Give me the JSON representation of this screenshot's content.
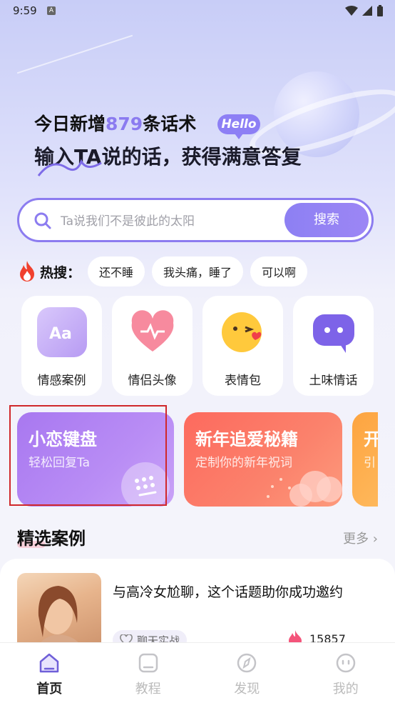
{
  "status": {
    "time": "9:59",
    "notif_letter": "A"
  },
  "hero": {
    "line1_prefix": "今日新增",
    "line1_number": "879",
    "line1_suffix": "条话术",
    "hello_badge": "Hello",
    "line2": "输入TA说的话，获得满意答复"
  },
  "search": {
    "placeholder": "Ta说我们不是彼此的太阳",
    "button_label": "搜索"
  },
  "hot_search": {
    "label": "热搜：",
    "tags": [
      "还不睡",
      "我头痛，睡了",
      "可以啊"
    ]
  },
  "categories": [
    {
      "label": "情感案例",
      "icon": "aa-icon"
    },
    {
      "label": "情侣头像",
      "icon": "heart-icon"
    },
    {
      "label": "表情包",
      "icon": "emoji-kiss-icon"
    },
    {
      "label": "土味情话",
      "icon": "chat-bubble-icon"
    }
  ],
  "banners": [
    {
      "title": "小恋键盘",
      "subtitle": "轻松回复Ta"
    },
    {
      "title": "新年追爱秘籍",
      "subtitle": "定制你的新年祝词"
    },
    {
      "title": "开",
      "subtitle": "引"
    }
  ],
  "featured": {
    "section_title": "精选案例",
    "more_label": "更多",
    "case": {
      "title": "与高冷女尬聊，这个话题助你成功邀约",
      "tag": "聊天实战",
      "count": "15857"
    }
  },
  "tabbar": [
    {
      "label": "首页",
      "active": true
    },
    {
      "label": "教程",
      "active": false
    },
    {
      "label": "发现",
      "active": false
    },
    {
      "label": "我的",
      "active": false
    }
  ],
  "colors": {
    "accent": "#8c7cf0",
    "highlight_border": "#d0282a",
    "banner1": "#a878f0",
    "banner2": "#fd6a5e",
    "banner3": "#fda440"
  }
}
